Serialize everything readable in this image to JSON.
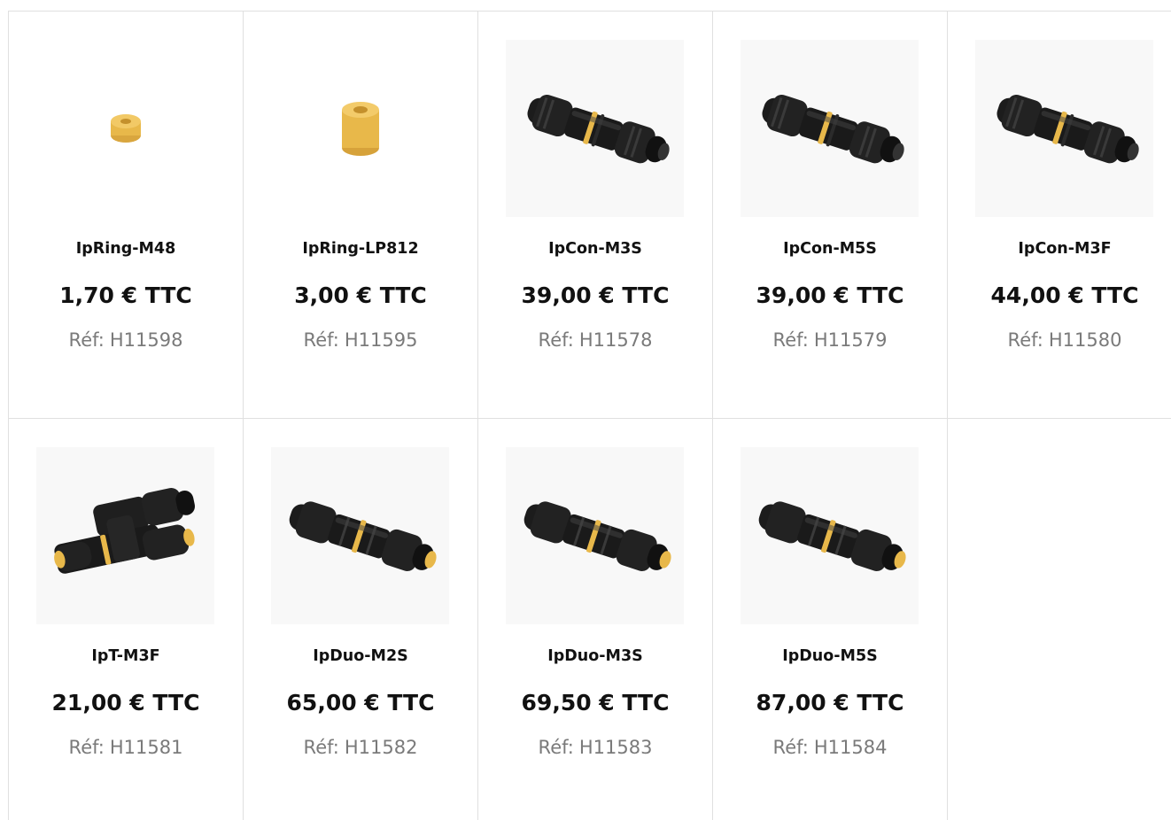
{
  "products": [
    {
      "name": "IpRing-M48",
      "price": "1,70 € TTC",
      "ref_label": "Réf:",
      "ref": "H11598",
      "image": "yellow-ring-small-icon"
    },
    {
      "name": "IpRing-LP812",
      "price": "3,00 € TTC",
      "ref_label": "Réf:",
      "ref": "H11595",
      "image": "yellow-ring-tall-icon"
    },
    {
      "name": "IpCon-M3S",
      "price": "39,00 € TTC",
      "ref_label": "Réf:",
      "ref": "H11578",
      "image": "inline-connector-icon"
    },
    {
      "name": "IpCon-M5S",
      "price": "39,00 € TTC",
      "ref_label": "Réf:",
      "ref": "H11579",
      "image": "inline-connector-icon"
    },
    {
      "name": "IpCon-M3F",
      "price": "44,00 € TTC",
      "ref_label": "Réf:",
      "ref": "H11580",
      "image": "inline-connector-icon"
    },
    {
      "name": "IpT-M3F",
      "price": "21,00 € TTC",
      "ref_label": "Réf:",
      "ref": "H11581",
      "image": "t-connector-icon"
    },
    {
      "name": "IpDuo-M2S",
      "price": "65,00 € TTC",
      "ref_label": "Réf:",
      "ref": "H11582",
      "image": "duo-connector-icon"
    },
    {
      "name": "IpDuo-M3S",
      "price": "69,50 € TTC",
      "ref_label": "Réf:",
      "ref": "H11583",
      "image": "duo-connector-icon"
    },
    {
      "name": "IpDuo-M5S",
      "price": "87,00 € TTC",
      "ref_label": "Réf:",
      "ref": "H11584",
      "image": "duo-connector-icon"
    }
  ],
  "colors": {
    "border": "#e0e0e0",
    "ref_text": "#7a7a7a",
    "accent_yellow": "#e8b84a",
    "connector_black": "#1c1c1c"
  }
}
